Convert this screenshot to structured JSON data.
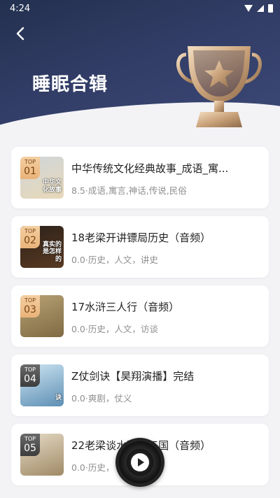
{
  "status_bar": {
    "time": "4:24"
  },
  "page": {
    "title": "睡眠合辑"
  },
  "items": [
    {
      "rank_label": "TOP",
      "rank": "01",
      "title": "中华传统文化经典故事_成语_寓...",
      "meta": "8.5·成语,寓言,神话,传说,民俗",
      "badge_style": "gold",
      "thumb_colors": [
        "#cfd6da",
        "#e8d8b8"
      ],
      "thumb_text": "中华文化故事"
    },
    {
      "rank_label": "TOP",
      "rank": "02",
      "title": "18老梁开讲镖局历史（音频）",
      "meta": "0.0·历史，人文，讲史",
      "badge_style": "gold",
      "thumb_colors": [
        "#2b211a",
        "#5a3a22"
      ],
      "thumb_text": "真实的 是怎样的"
    },
    {
      "rank_label": "TOP",
      "rank": "03",
      "title": "17水浒三人行（音频）",
      "meta": "0.0·历史，人文，访谈",
      "badge_style": "gold",
      "thumb_colors": [
        "#b8a274",
        "#7f6a44"
      ],
      "thumb_text": ""
    },
    {
      "rank_label": "TOP",
      "rank": "04",
      "title": "Z仗剑诀【昊翔演播】完结",
      "meta": "0.0·爽剧，仗义",
      "badge_style": "dark",
      "thumb_colors": [
        "#cfe6f3",
        "#5d8fb4"
      ],
      "thumb_text": "诀"
    },
    {
      "rank_label": "TOP",
      "rank": "05",
      "title": "22老梁谈水浒与三国（音频）",
      "meta": "0.0·历史，",
      "badge_style": "dark",
      "thumb_colors": [
        "#e5dbc6",
        "#a08a66"
      ],
      "thumb_text": ""
    }
  ]
}
